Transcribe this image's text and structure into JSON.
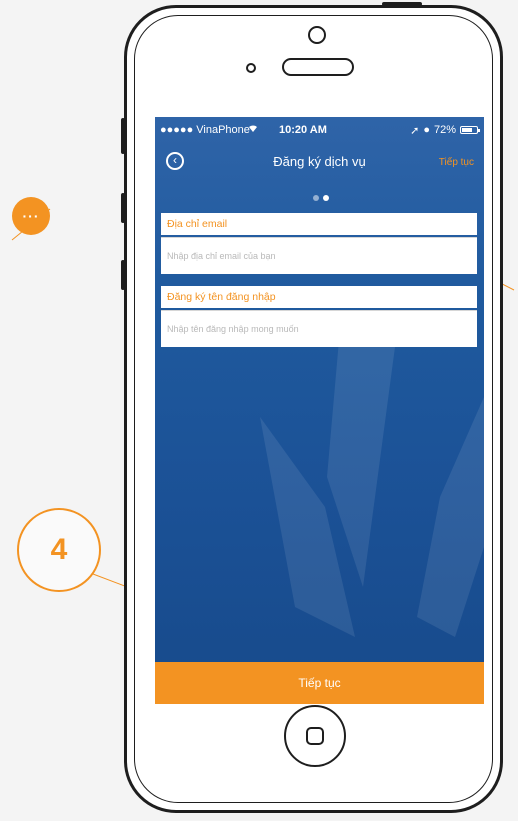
{
  "callouts": {
    "step_number": "4",
    "more_label": "···"
  },
  "status_bar": {
    "carrier": "●●●●● VinaPhone",
    "time": "10:20 AM",
    "battery": "72%",
    "battery_level": 0.72
  },
  "nav": {
    "title": "Đăng ký dịch vụ",
    "next_label": "Tiếp tục",
    "back_icon": "back-circle-icon"
  },
  "pager": {
    "total": 2,
    "active": 2
  },
  "form": {
    "email_label": "Địa chỉ email",
    "email_placeholder": "Nhập địa chỉ email của bạn",
    "username_label": "Đăng ký tên đăng nhập",
    "username_placeholder": "Nhập tên đăng nhập mong muốn"
  },
  "footer": {
    "continue_label": "Tiếp tục"
  },
  "colors": {
    "accent": "#f39322",
    "screen_bg": "#1f5a9e",
    "frame": "#1e1e1e"
  }
}
